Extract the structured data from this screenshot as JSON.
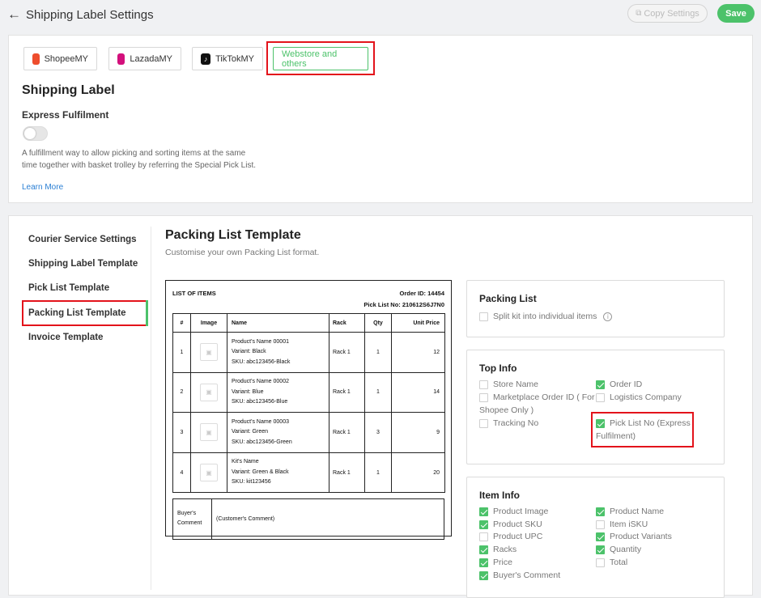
{
  "header": {
    "title": "Shipping Label Settings",
    "copy_label": "Copy Settings",
    "save_label": "Save"
  },
  "tabs": [
    {
      "label": "ShopeeMY",
      "icon": "shopee-icon",
      "color": "#ee4d2d"
    },
    {
      "label": "LazadaMY",
      "icon": "lazada-icon",
      "color": "#d3107c"
    },
    {
      "label": "TikTokMY",
      "icon": "tiktok-icon",
      "color": "#111111"
    },
    {
      "label": "Webstore and others",
      "active": true
    }
  ],
  "shipping_label": {
    "heading": "Shipping Label",
    "express_label": "Express Fulfilment",
    "express_enabled": false,
    "description": "A fulfillment way to allow picking and sorting items at the same time together with basket trolley by referring the Special Pick List.",
    "learn_more": "Learn More"
  },
  "sidebar": {
    "items": [
      {
        "label": "Courier Service Settings"
      },
      {
        "label": "Shipping Label Template"
      },
      {
        "label": "Pick List Template"
      },
      {
        "label": "Packing List Template",
        "active": true
      },
      {
        "label": "Invoice Template"
      }
    ]
  },
  "main": {
    "title": "Packing List Template",
    "subtitle": "Customise your own Packing List format."
  },
  "preview": {
    "list_title": "LIST OF ITEMS",
    "order_id": "Order ID: 14454",
    "pick_list_no": "Pick List No: 210612S6J7N0",
    "columns": [
      "#",
      "Image",
      "Name",
      "Rack",
      "Qty",
      "Unit Price"
    ],
    "rows": [
      {
        "no": "1",
        "name1": "Product's Name 00001",
        "name2": "Variant: Black",
        "name3": "SKU: abc123456-Black",
        "rack": "Rack 1",
        "qty": "1",
        "price": "12"
      },
      {
        "no": "2",
        "name1": "Product's Name 00002",
        "name2": "Variant: Blue",
        "name3": "SKU: abc123456-Blue",
        "rack": "Rack 1",
        "qty": "1",
        "price": "14"
      },
      {
        "no": "3",
        "name1": "Product's Name 00003",
        "name2": "Variant: Green",
        "name3": "SKU: abc123456-Green",
        "rack": "Rack 1",
        "qty": "3",
        "price": "9"
      },
      {
        "no": "4",
        "name1": "Kit's Name",
        "name2": "Variant: Green & Black",
        "name3": "SKU: kit123456",
        "rack": "Rack 1",
        "qty": "1",
        "price": "20"
      }
    ],
    "buyer_comment_label1": "Buyer's",
    "buyer_comment_label2": "Comment",
    "buyer_comment_value": "(Customer's Comment)"
  },
  "packing_list": {
    "heading": "Packing List",
    "split_kit": "Split kit into individual items",
    "split_kit_checked": false
  },
  "top_info": {
    "heading": "Top Info",
    "store_name": "Store Name",
    "store_name_checked": false,
    "order_id": "Order ID",
    "order_id_checked": true,
    "marketplace_order_id_1": "Marketplace Order ID ( For",
    "marketplace_order_id_2": "Shopee Only )",
    "marketplace_checked": false,
    "logistics_company": "Logistics Company",
    "logistics_checked": false,
    "tracking_no": "Tracking No",
    "tracking_checked": false,
    "pick_list_no_1": "Pick List No (Express",
    "pick_list_no_2": "Fulfilment)",
    "pick_list_checked": true
  },
  "item_info": {
    "heading": "Item Info",
    "options": [
      {
        "label": "Product Image",
        "checked": true
      },
      {
        "label": "Product Name",
        "checked": true
      },
      {
        "label": "Product SKU",
        "checked": true
      },
      {
        "label": "Item iSKU",
        "checked": false
      },
      {
        "label": "Product UPC",
        "checked": false
      },
      {
        "label": "Product Variants",
        "checked": true
      },
      {
        "label": "Racks",
        "checked": true
      },
      {
        "label": "Quantity",
        "checked": true
      },
      {
        "label": "Price",
        "checked": true
      },
      {
        "label": "Total",
        "checked": false
      },
      {
        "label": "Buyer's Comment",
        "checked": true
      }
    ]
  },
  "colors": {
    "accent": "#4cc26a",
    "highlight": "#e3131b",
    "link": "#2a7fd4"
  }
}
